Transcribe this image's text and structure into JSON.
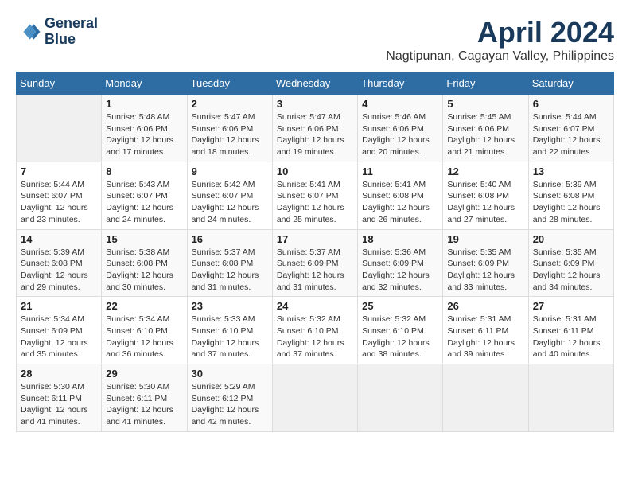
{
  "logo": {
    "line1": "General",
    "line2": "Blue"
  },
  "title": "April 2024",
  "subtitle": "Nagtipunan, Cagayan Valley, Philippines",
  "header": {
    "days": [
      "Sunday",
      "Monday",
      "Tuesday",
      "Wednesday",
      "Thursday",
      "Friday",
      "Saturday"
    ]
  },
  "weeks": [
    {
      "days": [
        {
          "number": "",
          "info": ""
        },
        {
          "number": "1",
          "info": "Sunrise: 5:48 AM\nSunset: 6:06 PM\nDaylight: 12 hours\nand 17 minutes."
        },
        {
          "number": "2",
          "info": "Sunrise: 5:47 AM\nSunset: 6:06 PM\nDaylight: 12 hours\nand 18 minutes."
        },
        {
          "number": "3",
          "info": "Sunrise: 5:47 AM\nSunset: 6:06 PM\nDaylight: 12 hours\nand 19 minutes."
        },
        {
          "number": "4",
          "info": "Sunrise: 5:46 AM\nSunset: 6:06 PM\nDaylight: 12 hours\nand 20 minutes."
        },
        {
          "number": "5",
          "info": "Sunrise: 5:45 AM\nSunset: 6:06 PM\nDaylight: 12 hours\nand 21 minutes."
        },
        {
          "number": "6",
          "info": "Sunrise: 5:44 AM\nSunset: 6:07 PM\nDaylight: 12 hours\nand 22 minutes."
        }
      ]
    },
    {
      "days": [
        {
          "number": "7",
          "info": "Sunrise: 5:44 AM\nSunset: 6:07 PM\nDaylight: 12 hours\nand 23 minutes."
        },
        {
          "number": "8",
          "info": "Sunrise: 5:43 AM\nSunset: 6:07 PM\nDaylight: 12 hours\nand 24 minutes."
        },
        {
          "number": "9",
          "info": "Sunrise: 5:42 AM\nSunset: 6:07 PM\nDaylight: 12 hours\nand 24 minutes."
        },
        {
          "number": "10",
          "info": "Sunrise: 5:41 AM\nSunset: 6:07 PM\nDaylight: 12 hours\nand 25 minutes."
        },
        {
          "number": "11",
          "info": "Sunrise: 5:41 AM\nSunset: 6:08 PM\nDaylight: 12 hours\nand 26 minutes."
        },
        {
          "number": "12",
          "info": "Sunrise: 5:40 AM\nSunset: 6:08 PM\nDaylight: 12 hours\nand 27 minutes."
        },
        {
          "number": "13",
          "info": "Sunrise: 5:39 AM\nSunset: 6:08 PM\nDaylight: 12 hours\nand 28 minutes."
        }
      ]
    },
    {
      "days": [
        {
          "number": "14",
          "info": "Sunrise: 5:39 AM\nSunset: 6:08 PM\nDaylight: 12 hours\nand 29 minutes."
        },
        {
          "number": "15",
          "info": "Sunrise: 5:38 AM\nSunset: 6:08 PM\nDaylight: 12 hours\nand 30 minutes."
        },
        {
          "number": "16",
          "info": "Sunrise: 5:37 AM\nSunset: 6:08 PM\nDaylight: 12 hours\nand 31 minutes."
        },
        {
          "number": "17",
          "info": "Sunrise: 5:37 AM\nSunset: 6:09 PM\nDaylight: 12 hours\nand 31 minutes."
        },
        {
          "number": "18",
          "info": "Sunrise: 5:36 AM\nSunset: 6:09 PM\nDaylight: 12 hours\nand 32 minutes."
        },
        {
          "number": "19",
          "info": "Sunrise: 5:35 AM\nSunset: 6:09 PM\nDaylight: 12 hours\nand 33 minutes."
        },
        {
          "number": "20",
          "info": "Sunrise: 5:35 AM\nSunset: 6:09 PM\nDaylight: 12 hours\nand 34 minutes."
        }
      ]
    },
    {
      "days": [
        {
          "number": "21",
          "info": "Sunrise: 5:34 AM\nSunset: 6:09 PM\nDaylight: 12 hours\nand 35 minutes."
        },
        {
          "number": "22",
          "info": "Sunrise: 5:34 AM\nSunset: 6:10 PM\nDaylight: 12 hours\nand 36 minutes."
        },
        {
          "number": "23",
          "info": "Sunrise: 5:33 AM\nSunset: 6:10 PM\nDaylight: 12 hours\nand 37 minutes."
        },
        {
          "number": "24",
          "info": "Sunrise: 5:32 AM\nSunset: 6:10 PM\nDaylight: 12 hours\nand 37 minutes."
        },
        {
          "number": "25",
          "info": "Sunrise: 5:32 AM\nSunset: 6:10 PM\nDaylight: 12 hours\nand 38 minutes."
        },
        {
          "number": "26",
          "info": "Sunrise: 5:31 AM\nSunset: 6:11 PM\nDaylight: 12 hours\nand 39 minutes."
        },
        {
          "number": "27",
          "info": "Sunrise: 5:31 AM\nSunset: 6:11 PM\nDaylight: 12 hours\nand 40 minutes."
        }
      ]
    },
    {
      "days": [
        {
          "number": "28",
          "info": "Sunrise: 5:30 AM\nSunset: 6:11 PM\nDaylight: 12 hours\nand 41 minutes."
        },
        {
          "number": "29",
          "info": "Sunrise: 5:30 AM\nSunset: 6:11 PM\nDaylight: 12 hours\nand 41 minutes."
        },
        {
          "number": "30",
          "info": "Sunrise: 5:29 AM\nSunset: 6:12 PM\nDaylight: 12 hours\nand 42 minutes."
        },
        {
          "number": "",
          "info": ""
        },
        {
          "number": "",
          "info": ""
        },
        {
          "number": "",
          "info": ""
        },
        {
          "number": "",
          "info": ""
        }
      ]
    }
  ]
}
